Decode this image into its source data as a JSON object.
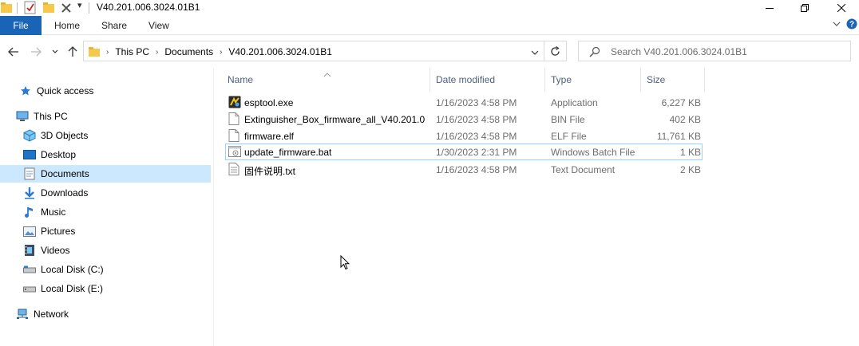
{
  "window": {
    "title": "V40.201.006.3024.01B1",
    "qat_dropdown": "▾"
  },
  "ribbon": {
    "tabs": [
      "File",
      "Home",
      "Share",
      "View"
    ],
    "help": "?"
  },
  "address": {
    "crumbs": [
      "This PC",
      "Documents",
      "V40.201.006.3024.01B1"
    ]
  },
  "search": {
    "placeholder": "Search V40.201.006.3024.01B1"
  },
  "nav": {
    "quick_access": "Quick access",
    "this_pc": "This PC",
    "objects_3d": "3D Objects",
    "desktop": "Desktop",
    "documents": "Documents",
    "downloads": "Downloads",
    "music": "Music",
    "pictures": "Pictures",
    "videos": "Videos",
    "local_c": "Local Disk (C:)",
    "local_e": "Local Disk (E:)",
    "network": "Network"
  },
  "columns": {
    "name": "Name",
    "date": "Date modified",
    "type": "Type",
    "size": "Size"
  },
  "files": [
    {
      "name": "esptool.exe",
      "date": "1/16/2023 4:58 PM",
      "type": "Application",
      "size": "6,227 KB",
      "icon": "application-icon"
    },
    {
      "name": "Extinguisher_Box_firmware_all_V40.201.0...",
      "date": "1/16/2023 4:58 PM",
      "type": "BIN File",
      "size": "402 KB",
      "icon": "document-icon"
    },
    {
      "name": "firmware.elf",
      "date": "1/16/2023 4:58 PM",
      "type": "ELF File",
      "size": "11,761 KB",
      "icon": "document-icon"
    },
    {
      "name": "update_firmware.bat",
      "date": "1/30/2023 2:31 PM",
      "type": "Windows Batch File",
      "size": "1 KB",
      "icon": "batch-file-icon"
    },
    {
      "name": "固件说明.txt",
      "date": "1/16/2023 4:58 PM",
      "type": "Text Document",
      "size": "2 KB",
      "icon": "text-file-icon"
    }
  ],
  "colors": {
    "accent": "#1a64b8",
    "selected": "#cce8ff",
    "header_text": "#4c607a"
  }
}
